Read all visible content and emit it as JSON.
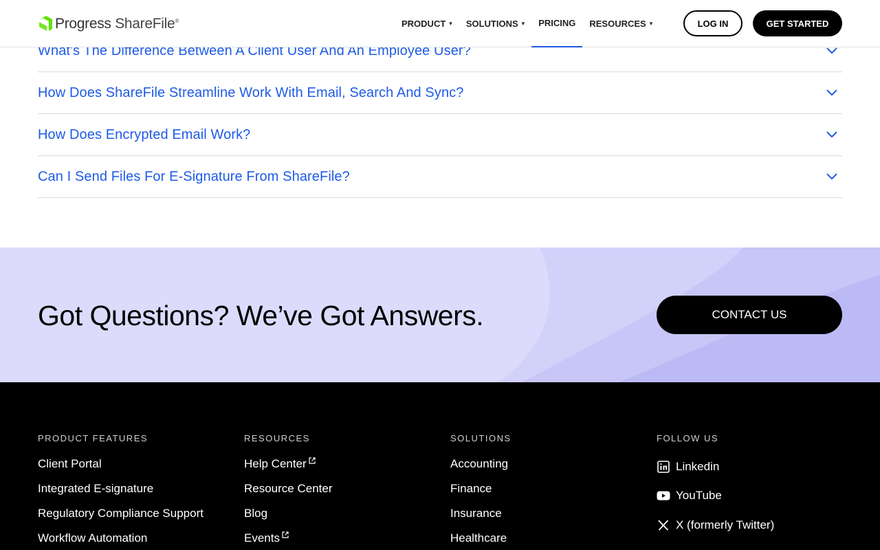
{
  "header": {
    "logo_word1": "Progress",
    "logo_word2": "ShareFile",
    "logo_reg": "®",
    "nav": [
      {
        "label": "PRODUCT",
        "caret": "▾"
      },
      {
        "label": "SOLUTIONS",
        "caret": "▾"
      },
      {
        "label": "PRICING"
      },
      {
        "label": "RESOURCES",
        "caret": "▾"
      }
    ],
    "login_label": "LOG IN",
    "start_label": "GET STARTED"
  },
  "faq": [
    "What's The Difference Between A Client User And An Employee User?",
    "How Does ShareFile Streamline Work With Email, Search And Sync?",
    "How Does Encrypted Email Work?",
    "Can I Send Files For E-Signature From ShareFile?"
  ],
  "cta": {
    "title": "Got Questions? We’ve Got Answers.",
    "button": "CONTACT US"
  },
  "footer": {
    "product": {
      "heading": "PRODUCT FEATURES",
      "links": [
        "Client Portal",
        "Integrated E-signature",
        "Regulatory Compliance Support",
        "Workflow Automation"
      ]
    },
    "resources": {
      "heading": "RESOURCES",
      "links": [
        "Help Center",
        "Resource Center",
        "Blog",
        "Events"
      ]
    },
    "solutions": {
      "heading": "SOLUTIONS",
      "links": [
        "Accounting",
        "Finance",
        "Insurance",
        "Healthcare"
      ]
    },
    "follow": {
      "heading": "FOLLOW US",
      "links": [
        "Linkedin",
        "YouTube",
        "X (formerly Twitter)"
      ]
    }
  },
  "colors": {
    "accent_blue": "#1f5be6",
    "logo_green": "#5ce500",
    "cta_bg": "#dcdbfb"
  }
}
